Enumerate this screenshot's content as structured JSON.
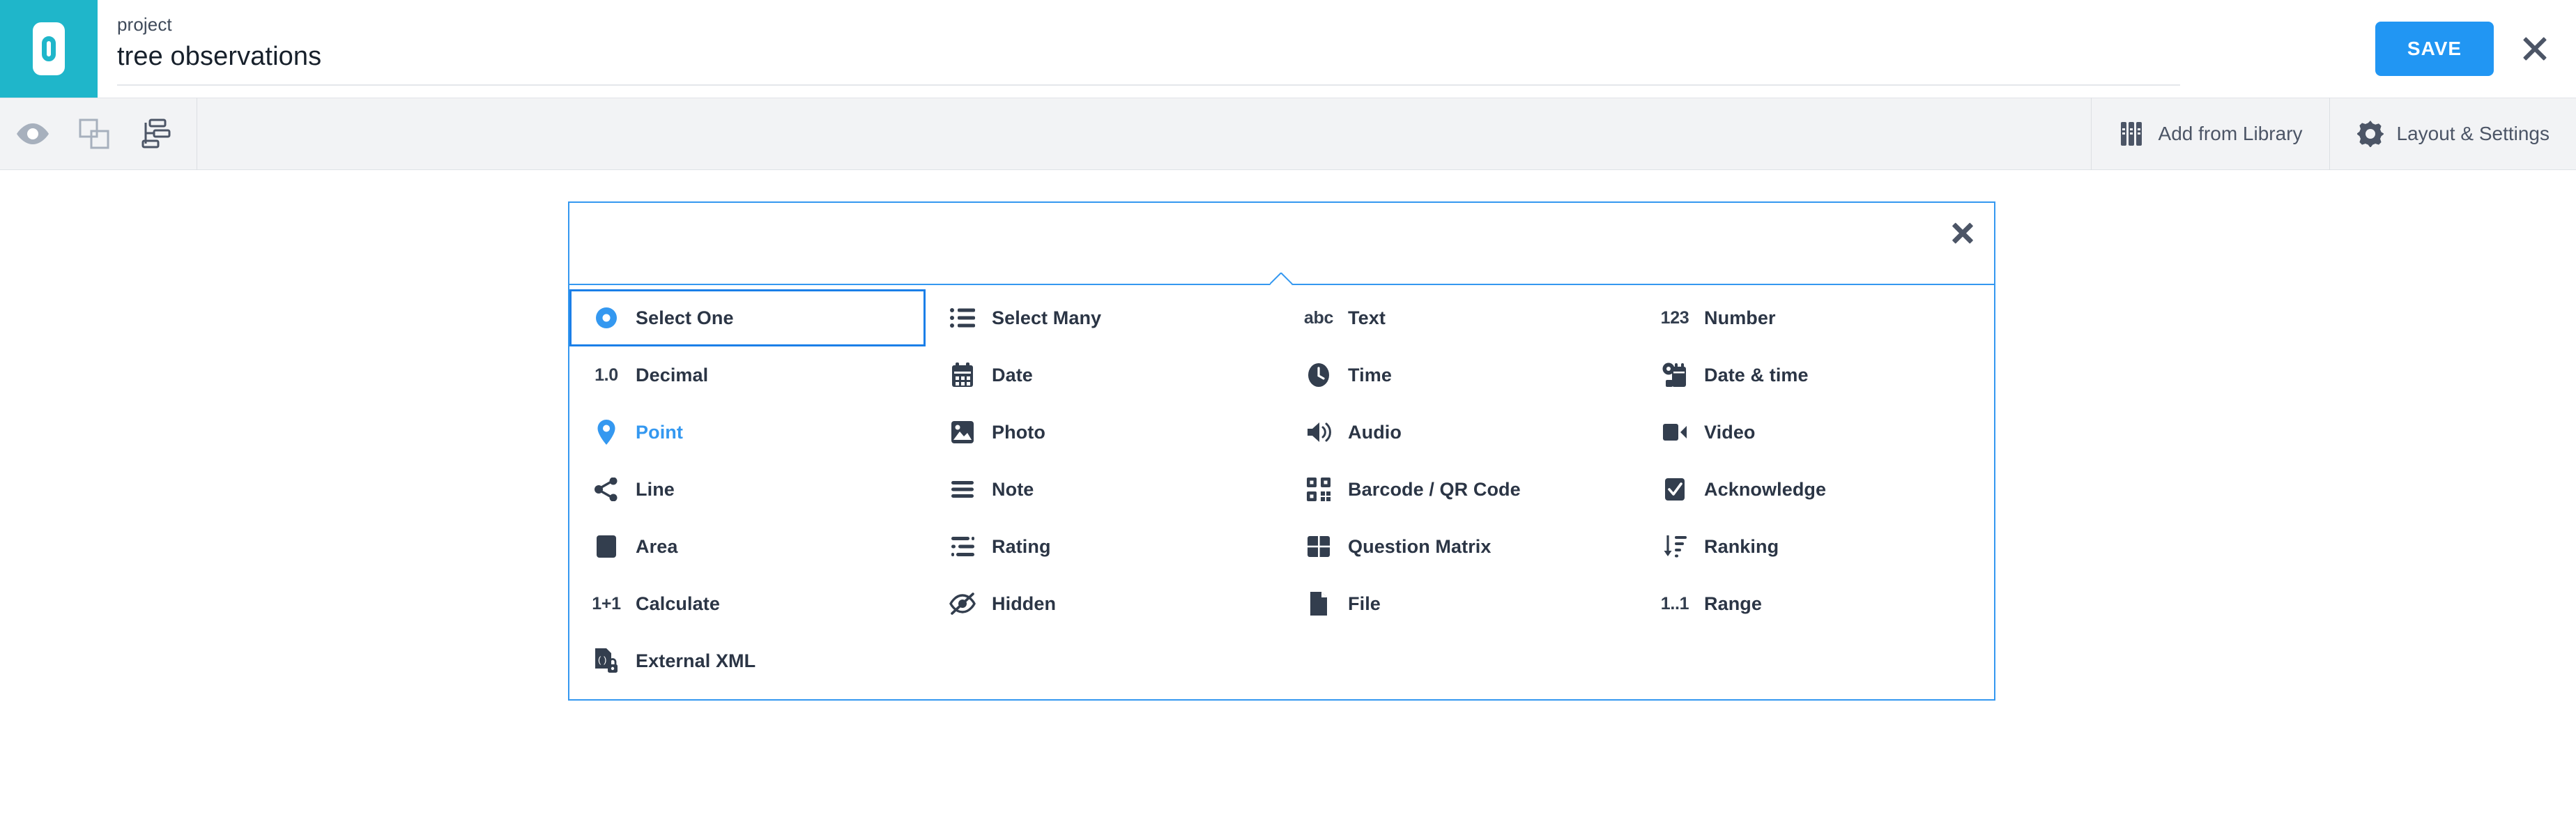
{
  "header": {
    "brand_icon": "mobile-device-icon",
    "kicker": "project",
    "title": "tree observations",
    "save_label": "SAVE",
    "close_icon": "close-icon",
    "accent_color": "#2196f3",
    "brand_color": "#1fb6ca"
  },
  "toolbar": {
    "left_tools": [
      {
        "name": "preview-icon",
        "icon": "eye"
      },
      {
        "name": "duplicate-icon",
        "icon": "copy"
      },
      {
        "name": "flow-logic-icon",
        "icon": "flowchart"
      }
    ],
    "add_from_library_label": "Add from Library",
    "add_from_library_icon": "library-books-icon",
    "layout_settings_label": "Layout & Settings",
    "layout_settings_icon": "gear-icon"
  },
  "panel": {
    "close_icon": "close-icon",
    "border_color": "#3498f0",
    "selected_type": "Select One",
    "highlighted_type": "Point",
    "types": [
      {
        "label": "Select One",
        "icon": "radio-button-icon",
        "glyph": "",
        "state": "selected"
      },
      {
        "label": "Select Many",
        "icon": "checklist-icon",
        "glyph": "",
        "state": "default"
      },
      {
        "label": "Text",
        "icon": "abc-icon",
        "glyph": "abc",
        "state": "default"
      },
      {
        "label": "Number",
        "icon": "number-icon",
        "glyph": "123",
        "state": "default"
      },
      {
        "label": "Decimal",
        "icon": "decimal-icon",
        "glyph": "1.0",
        "state": "default"
      },
      {
        "label": "Date",
        "icon": "calendar-icon",
        "glyph": "",
        "state": "default"
      },
      {
        "label": "Time",
        "icon": "clock-icon",
        "glyph": "",
        "state": "default"
      },
      {
        "label": "Date & time",
        "icon": "date-time-icon",
        "glyph": "",
        "state": "default"
      },
      {
        "label": "Point",
        "icon": "map-pin-icon",
        "glyph": "",
        "state": "accent"
      },
      {
        "label": "Photo",
        "icon": "photo-icon",
        "glyph": "",
        "state": "default"
      },
      {
        "label": "Audio",
        "icon": "audio-speaker-icon",
        "glyph": "",
        "state": "default"
      },
      {
        "label": "Video",
        "icon": "video-camera-icon",
        "glyph": "",
        "state": "default"
      },
      {
        "label": "Line",
        "icon": "line-share-icon",
        "glyph": "",
        "state": "default"
      },
      {
        "label": "Note",
        "icon": "note-lines-icon",
        "glyph": "",
        "state": "default"
      },
      {
        "label": "Barcode / QR Code",
        "icon": "qr-code-icon",
        "glyph": "",
        "state": "default"
      },
      {
        "label": "Acknowledge",
        "icon": "checkbox-check-icon",
        "glyph": "",
        "state": "default"
      },
      {
        "label": "Area",
        "icon": "area-square-icon",
        "glyph": "",
        "state": "default"
      },
      {
        "label": "Rating",
        "icon": "rating-sliders-icon",
        "glyph": "",
        "state": "default"
      },
      {
        "label": "Question Matrix",
        "icon": "matrix-grid-icon",
        "glyph": "",
        "state": "default"
      },
      {
        "label": "Ranking",
        "icon": "ranking-sort-icon",
        "glyph": "",
        "state": "default"
      },
      {
        "label": "Calculate",
        "icon": "calculate-icon",
        "glyph": "1+1",
        "state": "default"
      },
      {
        "label": "Hidden",
        "icon": "eye-slash-icon",
        "glyph": "",
        "state": "default"
      },
      {
        "label": "File",
        "icon": "file-icon",
        "glyph": "",
        "state": "default"
      },
      {
        "label": "Range",
        "icon": "range-icon",
        "glyph": "1..1",
        "state": "default"
      },
      {
        "label": "External XML",
        "icon": "external-xml-icon",
        "glyph": "",
        "state": "default"
      }
    ]
  }
}
